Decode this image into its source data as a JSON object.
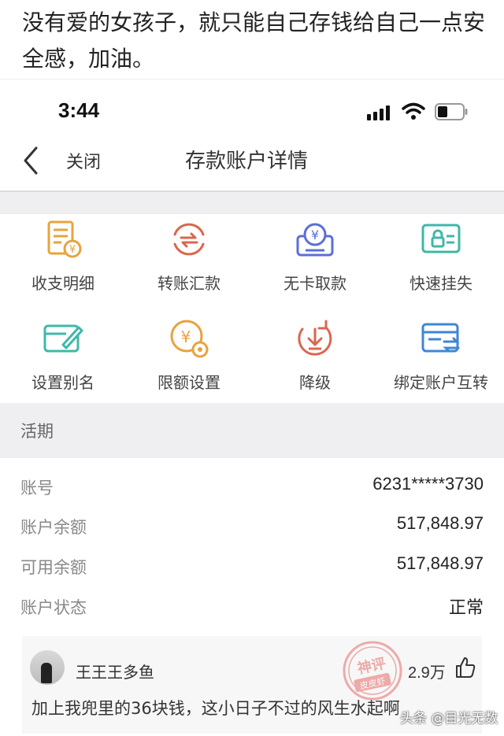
{
  "caption": "没有爱的女孩子，就只能自己存钱给自己一点安全感，加油。",
  "status_bar": {
    "time": "3:44"
  },
  "nav": {
    "close_label": "关闭",
    "title": "存款账户详情"
  },
  "actions": [
    {
      "label": "收支明细",
      "icon": "statement-icon",
      "color": "#e8a33d"
    },
    {
      "label": "转账汇款",
      "icon": "transfer-icon",
      "color": "#d9674f"
    },
    {
      "label": "无卡取款",
      "icon": "cardless-withdraw-icon",
      "color": "#5b6fd6"
    },
    {
      "label": "快速挂失",
      "icon": "report-loss-icon",
      "color": "#3fb8a8"
    },
    {
      "label": "设置别名",
      "icon": "edit-alias-icon",
      "color": "#3fb8a8"
    },
    {
      "label": "限额设置",
      "icon": "limit-settings-icon",
      "color": "#e8a33d"
    },
    {
      "label": "降级",
      "icon": "downgrade-icon",
      "color": "#d9674f"
    },
    {
      "label": "绑定账户互转",
      "icon": "bind-account-icon",
      "color": "#3f86d6"
    }
  ],
  "section": {
    "title": "活期"
  },
  "details": [
    {
      "label": "账号",
      "value": "6231*****3730"
    },
    {
      "label": "账户余额",
      "value": "517,848.97"
    },
    {
      "label": "可用余额",
      "value": "517,848.97"
    },
    {
      "label": "账户状态",
      "value": "正常"
    }
  ],
  "comment": {
    "username": "王王王多鱼",
    "likes": "2.9万",
    "text": "加上我兜里的36块钱，这小日子不过的风生水起啊"
  },
  "stamp": {
    "line1": "神评",
    "line2": "皮皮虾"
  },
  "watermark": "头条 @目光无数"
}
